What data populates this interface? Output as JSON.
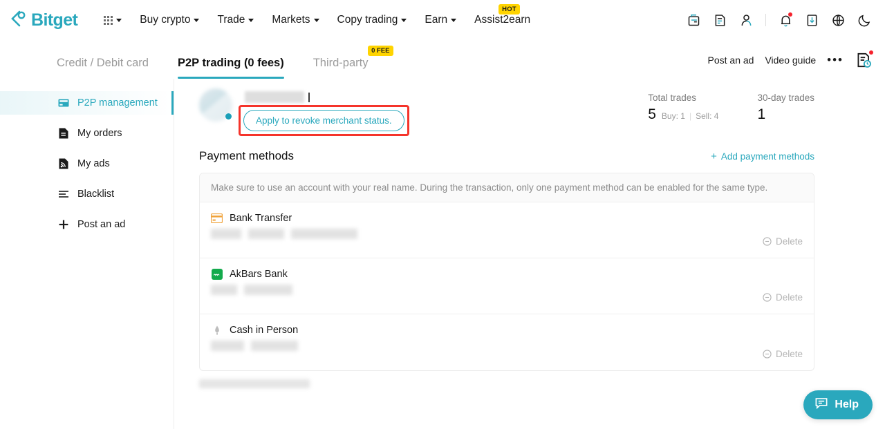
{
  "brand": {
    "name": "Bitget",
    "accent": "#2aa8bd",
    "badge_yellow": "#ffd400",
    "annotation_red": "#f5342b"
  },
  "topnav": {
    "apps_icon": "grid-apps-icon",
    "items": [
      {
        "label": "Buy crypto",
        "caret": true,
        "badge": null
      },
      {
        "label": "Trade",
        "caret": true,
        "badge": null
      },
      {
        "label": "Markets",
        "caret": true,
        "badge": null
      },
      {
        "label": "Copy trading",
        "caret": true,
        "badge": null
      },
      {
        "label": "Earn",
        "caret": true,
        "badge": null
      },
      {
        "label": "Assist2earn",
        "caret": false,
        "badge": "HOT"
      }
    ],
    "right_icons": [
      "wallet-icon",
      "orders-icon",
      "account-icon",
      "notification-bell-icon",
      "download-icon",
      "language-globe-icon",
      "dark-mode-moon-icon"
    ]
  },
  "tabs": [
    {
      "label": "Credit / Debit card",
      "active": false,
      "badge": null
    },
    {
      "label": "P2P trading (0 fees)",
      "active": true,
      "badge": null
    },
    {
      "label": "Third-party",
      "active": false,
      "badge": "0 FEE"
    }
  ],
  "tab_actions": {
    "post_an_ad": "Post an ad",
    "video_guide": "Video guide",
    "more": "•••",
    "order_history_icon": "order-history-icon"
  },
  "sidebar": {
    "items": [
      {
        "label": "P2P management",
        "icon": "card-management-icon",
        "active": true
      },
      {
        "label": "My orders",
        "icon": "document-icon",
        "active": false
      },
      {
        "label": "My ads",
        "icon": "ads-feed-icon",
        "active": false
      },
      {
        "label": "Blacklist",
        "icon": "list-lines-icon",
        "active": false
      },
      {
        "label": "Post an ad",
        "icon": "plus-icon",
        "active": false
      }
    ]
  },
  "profile": {
    "avatar": "user-avatar-blurred",
    "online_status": "online",
    "username_masked": "",
    "revoke_button": "Apply to revoke merchant status."
  },
  "stats": [
    {
      "label": "Total trades",
      "value": "5",
      "buy_label": "Buy: 1",
      "sell_label": "Sell: 4"
    },
    {
      "label": "30-day trades",
      "value": "1",
      "buy_label": "",
      "sell_label": ""
    }
  ],
  "payment_methods": {
    "title": "Payment methods",
    "add_label": "Add payment methods",
    "notice": "Make sure to use an account with your real name. During the transaction, only one payment method can be enabled for the same type.",
    "delete_label": "Delete",
    "rows": [
      {
        "name": "Bank Transfer",
        "icon": "bank-card-icon",
        "icon_color": "#f0a33c",
        "masked_widths": [
          44,
          52,
          96
        ]
      },
      {
        "name": "AkBars Bank",
        "icon": "akbars-bank-icon",
        "icon_color": "#13aa4c",
        "masked_widths": [
          38,
          70
        ]
      },
      {
        "name": "Cash in Person",
        "icon": "cash-person-icon",
        "icon_color": "#9e9e9e",
        "masked_widths": [
          48,
          68
        ]
      }
    ]
  },
  "help": {
    "label": "Help",
    "icon": "chat-help-icon"
  }
}
